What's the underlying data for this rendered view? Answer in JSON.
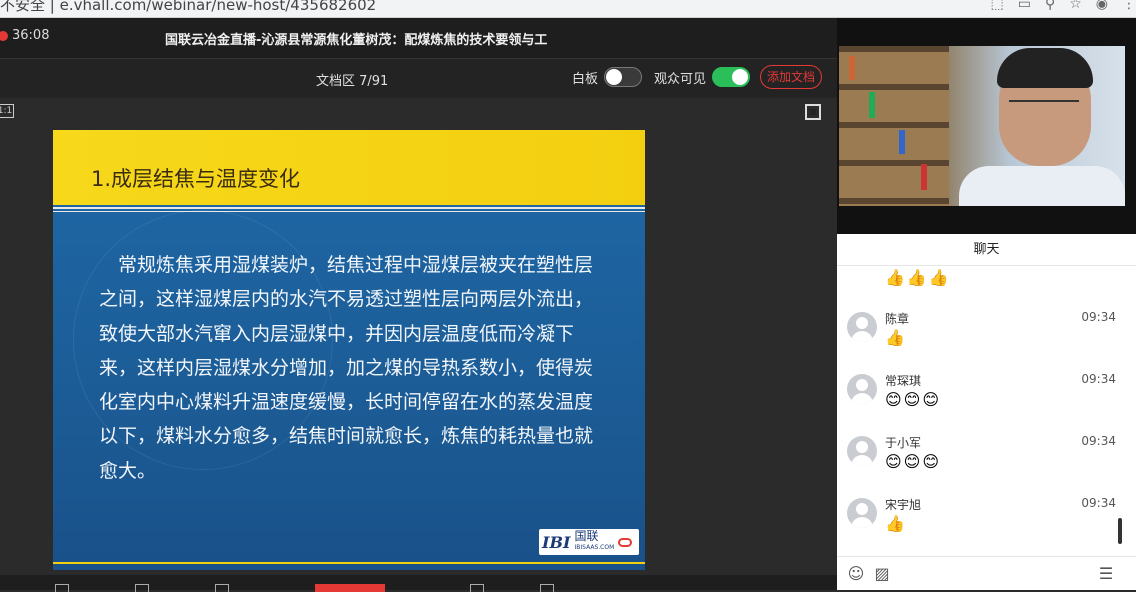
{
  "browser": {
    "url": "不安全 | e.vhall.com/webinar/new-host/435682602"
  },
  "header": {
    "timer": "36:08",
    "title": "国联云冶金直播-沁源县常源焦化董树茂：配煤炼焦的技术要领与工"
  },
  "toolbar": {
    "doc_area": "文档区 7/91",
    "whiteboard_label": "白板",
    "whiteboard_on": false,
    "audience_visible_label": "观众可见",
    "audience_visible_on": true,
    "add_doc_label": "添加文档",
    "ratio_label": "1:1"
  },
  "slide": {
    "title": "1.成层结焦与温度变化",
    "body": "常规炼焦采用湿煤装炉，结焦过程中湿煤层被夹在塑性层之间，这样湿煤层内的水汽不易透过塑性层向两层外流出，致使大部水汽窜入内层湿煤中，并因内层温度低而冷凝下来，这样内层湿煤水分增加，加之煤的导热系数小，使得炭化室内中心煤料升温速度缓慢，长时间停留在水的蒸发温度以下，煤料水分愈多，结焦时间就愈长，炼焦的耗热量也就愈大。",
    "logo_main": "IBI",
    "logo_cn": "国联",
    "logo_sub": "IBISAAS.COM"
  },
  "chat": {
    "header": "聊天",
    "top_emojis": "👍👍👍",
    "messages": [
      {
        "name": "陈章",
        "time": "09:34",
        "emoji": "👍"
      },
      {
        "name": "常琛琪",
        "time": "09:34",
        "emoji": "😊😊😊"
      },
      {
        "name": "于小军",
        "time": "09:34",
        "emoji": "😊😊😊"
      },
      {
        "name": "宋宇旭",
        "time": "09:34",
        "emoji": "👍"
      }
    ]
  },
  "colors": {
    "accent_red": "#e53935",
    "toggle_green": "#2bbf5a",
    "slide_blue": "#1e69a8",
    "slide_yellow": "#f7d81a"
  }
}
